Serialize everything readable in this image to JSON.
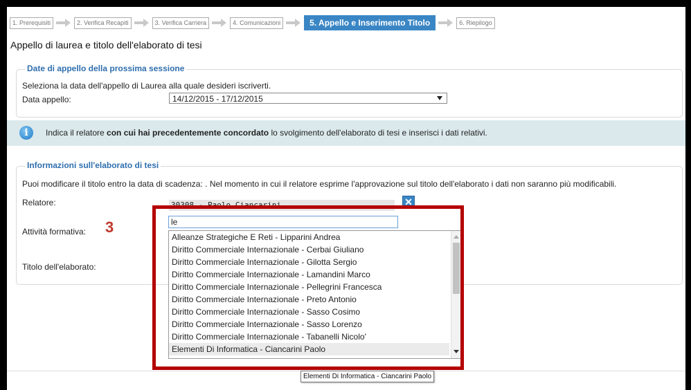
{
  "steps": [
    {
      "label": "1. Prerequisiti"
    },
    {
      "label": "2. Verifica Recapiti"
    },
    {
      "label": "3. Verifica Carriera"
    },
    {
      "label": "4. Comunicazioni"
    },
    {
      "label": "5. Appello e Inserimento Titolo"
    },
    {
      "label": "6. Riepilogo"
    }
  ],
  "page_title": "Appello di laurea e titolo dell'elaborato di tesi",
  "session": {
    "legend": "Date di appello della prossima sessione",
    "instruction": "Seleziona la data dell'appello di Laurea alla quale desideri iscriverti.",
    "date_label": "Data appello:",
    "date_value": "14/12/2015 - 17/12/2015"
  },
  "info": {
    "icon": "info-icon",
    "text_before": "Indica il relatore ",
    "text_bold": "con cui hai precedentemente concordato",
    "text_after": " lo svolgimento dell'elaborato di tesi e inserisci i dati relativi."
  },
  "thesis": {
    "legend": "Informazioni sull'elaborato di tesi",
    "note": "Puoi modificare il titolo entro la data di scadenza: . Nel momento in cui il relatore esprime l'approvazione sul titolo dell'elaborato i dati non saranno più modificabili.",
    "relatore_label": "Relatore:",
    "relatore_value": "30308 - Paolo Ciancarini",
    "remove_label": "✕",
    "attivita_label": "Attività formativa:",
    "attivita_value": "le",
    "titolo_label": "Titolo dell'elaborato:"
  },
  "annotation": "3",
  "dropdown_options": [
    "Alleanze Strategiche E Reti - Lipparini Andrea",
    "Diritto Commerciale Internazionale - Cerbai Giuliano",
    "Diritto Commerciale Internazionale - Gilotta Sergio",
    "Diritto Commerciale Internazionale - Lamandini Marco",
    "Diritto Commerciale Internazionale - Pellegrini Francesca",
    "Diritto Commerciale Internazionale - Preto Antonio",
    "Diritto Commerciale Internazionale - Sasso Cosimo",
    "Diritto Commerciale Internazionale - Sasso Lorenzo",
    "Diritto Commerciale Internazionale - Tabanelli Nicolo'",
    "Elementi Di Informatica - Ciancarini Paolo"
  ],
  "tooltip": "Elementi Di Informatica - Ciancarini Paolo",
  "colors": {
    "accent": "#3a86c5",
    "legend": "#2f6fae",
    "annotation_box": "#b40000",
    "info_bg": "#dbe9ec"
  }
}
